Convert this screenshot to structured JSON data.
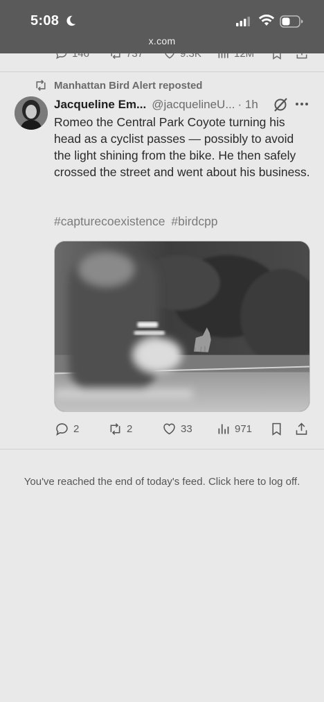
{
  "status_bar": {
    "time": "5:08",
    "url": "x.com",
    "icons": [
      "moon-icon",
      "signal-icon",
      "wifi-icon",
      "battery-icon"
    ]
  },
  "previous_tweet_actions": {
    "replies": "146",
    "reposts": "737",
    "likes": "9.3K",
    "views": "12M"
  },
  "tweet": {
    "repost_label": "Manhattan Bird Alert reposted",
    "author_name": "Jacqueline Em...",
    "author_handle": "@jacquelineU...",
    "time": "· 1h",
    "text": "Romeo the Central Park Coyote turning his head as a cyclist passes — possibly to avoid the light shining from the bike. He then safely crossed the street and went about his business.",
    "hashtags": [
      "#capturecoexistence",
      "#birdcpp"
    ],
    "actions": {
      "replies": "2",
      "reposts": "2",
      "likes": "33",
      "views": "971"
    }
  },
  "feed_end": {
    "text": "You've reached the end of today's feed. Click here to log off."
  }
}
